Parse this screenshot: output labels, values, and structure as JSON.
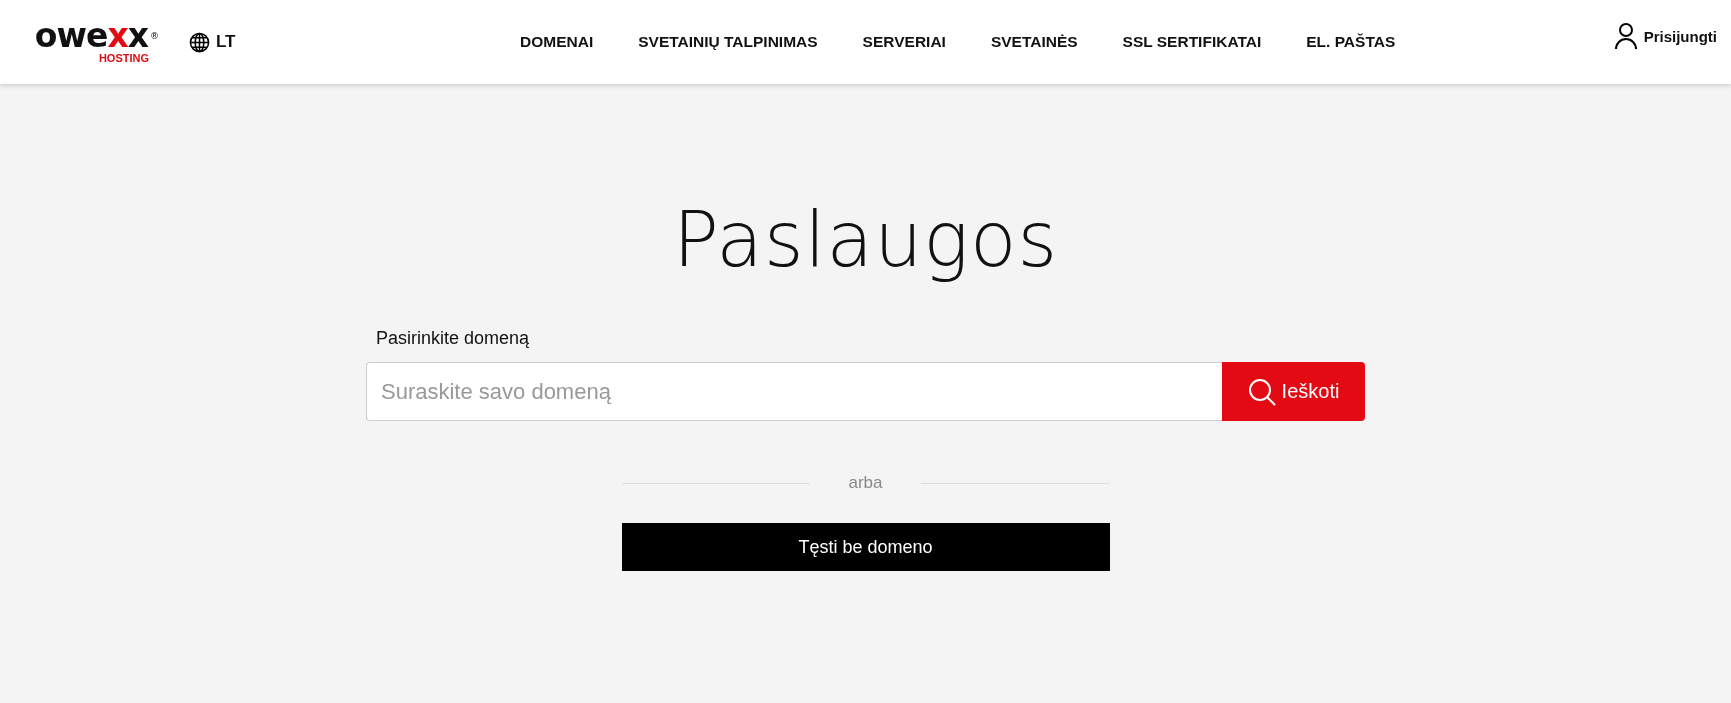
{
  "header": {
    "logo": {
      "parts": [
        {
          "text": "owe",
          "accent": false
        },
        {
          "text": "x",
          "accent": true
        },
        {
          "text": "x",
          "accent": false
        }
      ],
      "mark": "®",
      "tagline": "HOSTING"
    },
    "language": "LT",
    "nav": [
      "DOMENAI",
      "SVETAINIŲ TALPINIMAS",
      "SERVERIAI",
      "SVETAINĖS",
      "SSL SERTIFIKATAI",
      "EL. PAŠTAS"
    ],
    "login": "Prisijungti"
  },
  "title": "Paslaugos",
  "domain_search": {
    "label": "Pasirinkite domeną",
    "placeholder": "Suraskite savo domeną",
    "button": "Ieškoti"
  },
  "separator": "arba",
  "continue_button": "Tęsti be domeno"
}
